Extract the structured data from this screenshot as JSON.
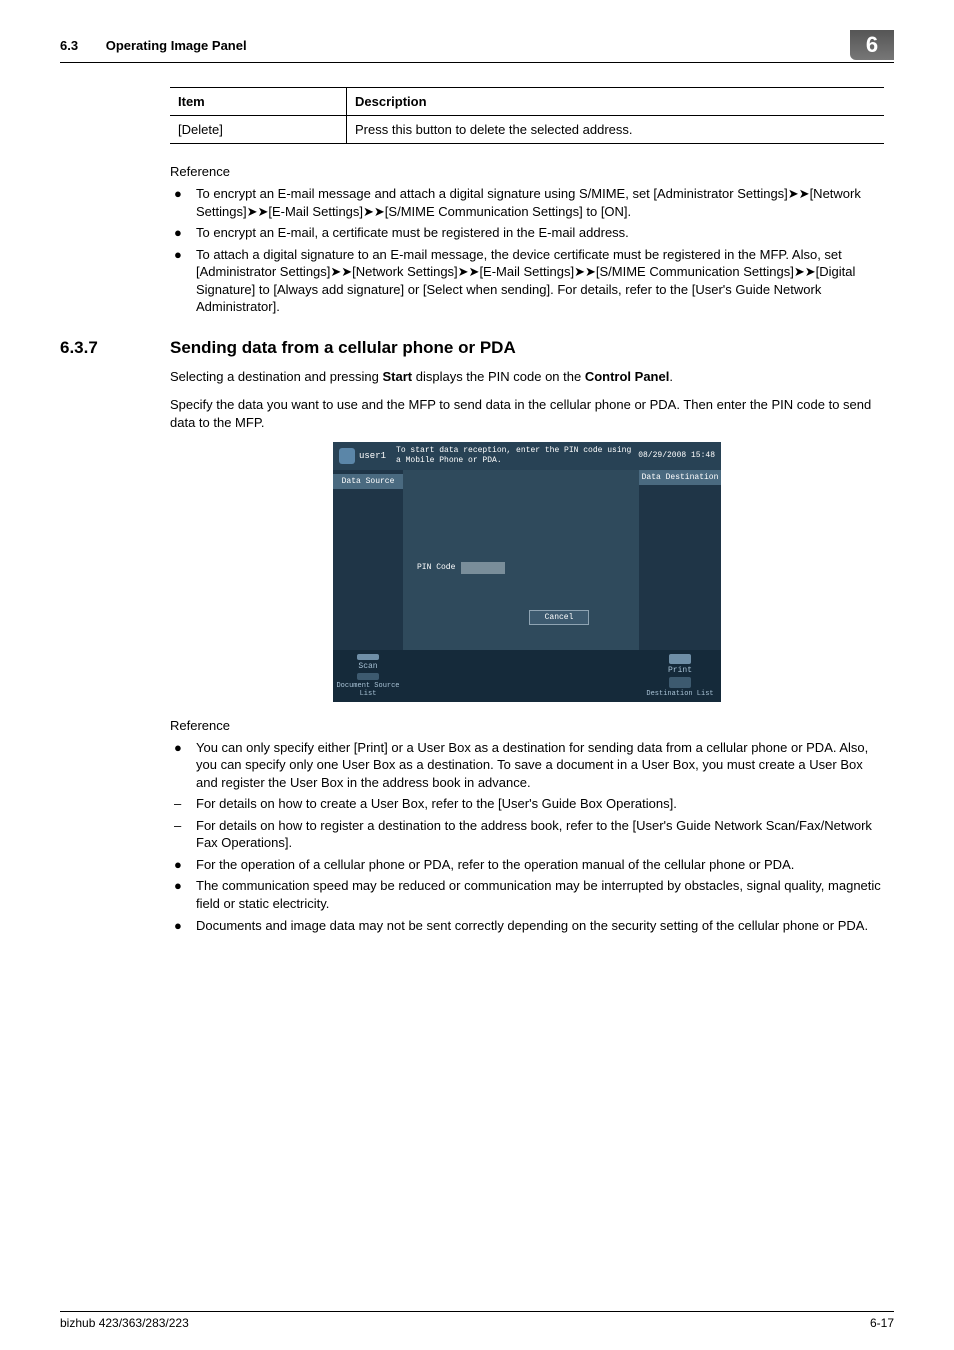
{
  "header": {
    "secnum": "6.3",
    "title": "Operating Image Panel",
    "chapterBadge": "6"
  },
  "table": {
    "col1": "Item",
    "col2": "Description",
    "row1c1": "[Delete]",
    "row1c2": "Press this button to delete the selected address."
  },
  "ref1": {
    "label": "Reference",
    "items": [
      {
        "bullet": "●",
        "text": "To encrypt an E-mail message and attach a digital signature using S/MIME, set [Administrator Settings]➤➤[Network Settings]➤➤[E-Mail Settings]➤➤[S/MIME Communication Settings] to [ON]."
      },
      {
        "bullet": "●",
        "text": "To encrypt an E-mail, a certificate must be registered in the E-mail address."
      },
      {
        "bullet": "●",
        "text": "To attach a digital signature to an E-mail message, the device certificate must be registered in the MFP. Also, set [Administrator Settings]➤➤[Network Settings]➤➤[E-Mail Settings]➤➤[S/MIME Communication Settings]➤➤[Digital Signature] to [Always add signature] or [Select when sending]. For details, refer to the [User's Guide Network Administrator]."
      }
    ]
  },
  "heading": {
    "num": "6.3.7",
    "text": "Sending data from a cellular phone or PDA"
  },
  "para1a": "Selecting a destination and pressing ",
  "para1b": "Start",
  "para1c": " displays the PIN code on the ",
  "para1d": "Control Panel",
  "para1e": ".",
  "para2": "Specify the data you want to use and the MFP to send data in the cellular phone or PDA. Then enter the PIN code to send data to the MFP.",
  "screenshot": {
    "user": "user1",
    "msg": "To start data reception, enter the PIN code using a Mobile Phone or PDA.",
    "datetime": "08/29/2008  15:48",
    "dataSource": "Data Source",
    "dataDest": "Data Destination",
    "pinLabel": "PIN Code",
    "cancel": "Cancel",
    "scan": "Scan",
    "docSrc": "Document Source List",
    "print": "Print",
    "destList": "Destination List"
  },
  "ref2": {
    "label": "Reference",
    "items": [
      {
        "bullet": "●",
        "text": "You can only specify either [Print] or a User Box as a destination for sending data from a cellular phone or PDA. Also, you can specify only one User Box as a destination. To save a document in a User Box, you must create a User Box and register the User Box in the address book in advance."
      },
      {
        "bullet": "–",
        "text": "For details on how to create a User Box, refer to the [User's Guide Box Operations]."
      },
      {
        "bullet": "–",
        "text": "For details on how to register a destination to the address book, refer to the [User's Guide Network Scan/Fax/Network Fax Operations]."
      },
      {
        "bullet": "●",
        "text": "For the operation of a cellular phone or PDA, refer to the operation manual of the cellular phone or PDA."
      },
      {
        "bullet": "●",
        "text": "The communication speed may be reduced or communication may be interrupted by obstacles, signal quality, magnetic field or static electricity."
      },
      {
        "bullet": "●",
        "text": "Documents and image data may not be sent correctly depending on the security setting of the cellular phone or PDA."
      }
    ]
  },
  "footer": {
    "left": "bizhub 423/363/283/223",
    "right": "6-17"
  }
}
